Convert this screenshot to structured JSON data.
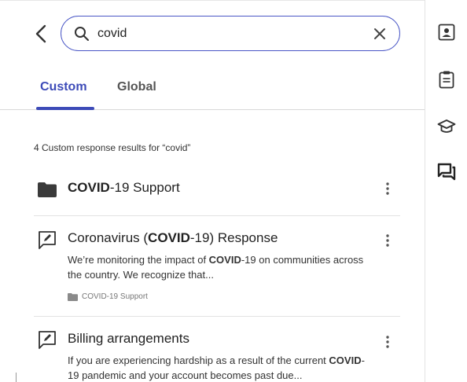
{
  "search": {
    "query": "covid",
    "placeholder": ""
  },
  "tabs": [
    {
      "label": "Custom",
      "active": true
    },
    {
      "label": "Global",
      "active": false
    }
  ],
  "summary": "4 Custom response results for “covid”",
  "results": [
    {
      "type": "folder",
      "title_bold": "COVID",
      "title_rest": "-19 Support"
    },
    {
      "type": "response",
      "title_pre": "Coronavirus (",
      "title_bold": "COVID",
      "title_post": "-19) Response",
      "desc_pre": "We’re monitoring the impact of ",
      "desc_bold": "COVID",
      "desc_post": "-19 on communities across the country. We recognize that...",
      "folder": "COVID-19 Support"
    },
    {
      "type": "response",
      "title": "Billing arrangements",
      "desc_pre": "If you are experiencing hardship as a result of the current ",
      "desc_bold": "COVID",
      "desc_post": "-19 pandemic and your account becomes past due..."
    }
  ],
  "rail": [
    "contact-card-icon",
    "clipboard-icon",
    "graduation-cap-icon",
    "chat-bubbles-icon"
  ],
  "colors": {
    "accent": "#3d4bb8",
    "search_border": "#4a57c6"
  }
}
